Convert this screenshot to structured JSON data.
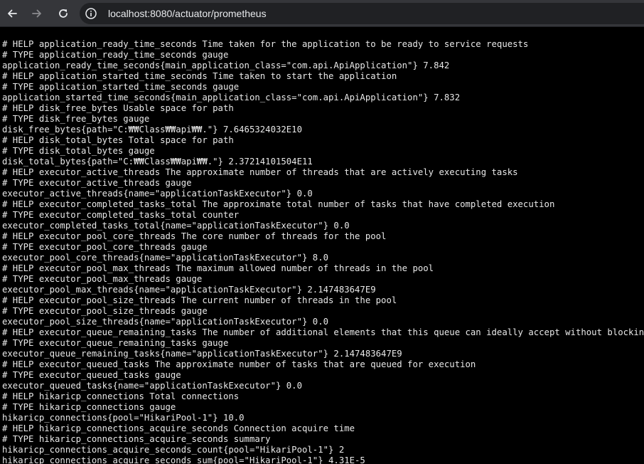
{
  "browser": {
    "url": "localhost:8080/actuator/prometheus"
  },
  "lines": [
    "# HELP application_ready_time_seconds Time taken for the application to be ready to service requests",
    "# TYPE application_ready_time_seconds gauge",
    "application_ready_time_seconds{main_application_class=\"com.api.ApiApplication\"} 7.842",
    "# HELP application_started_time_seconds Time taken to start the application",
    "# TYPE application_started_time_seconds gauge",
    "application_started_time_seconds{main_application_class=\"com.api.ApiApplication\"} 7.832",
    "# HELP disk_free_bytes Usable space for path",
    "# TYPE disk_free_bytes gauge",
    "disk_free_bytes{path=\"C:₩₩Class₩₩api₩₩.\"} 7.6465324032E10",
    "# HELP disk_total_bytes Total space for path",
    "# TYPE disk_total_bytes gauge",
    "disk_total_bytes{path=\"C:₩₩Class₩₩api₩₩.\"} 2.37214101504E11",
    "# HELP executor_active_threads The approximate number of threads that are actively executing tasks",
    "# TYPE executor_active_threads gauge",
    "executor_active_threads{name=\"applicationTaskExecutor\"} 0.0",
    "# HELP executor_completed_tasks_total The approximate total number of tasks that have completed execution",
    "# TYPE executor_completed_tasks_total counter",
    "executor_completed_tasks_total{name=\"applicationTaskExecutor\"} 0.0",
    "# HELP executor_pool_core_threads The core number of threads for the pool",
    "# TYPE executor_pool_core_threads gauge",
    "executor_pool_core_threads{name=\"applicationTaskExecutor\"} 8.0",
    "# HELP executor_pool_max_threads The maximum allowed number of threads in the pool",
    "# TYPE executor_pool_max_threads gauge",
    "executor_pool_max_threads{name=\"applicationTaskExecutor\"} 2.147483647E9",
    "# HELP executor_pool_size_threads The current number of threads in the pool",
    "# TYPE executor_pool_size_threads gauge",
    "executor_pool_size_threads{name=\"applicationTaskExecutor\"} 0.0",
    "# HELP executor_queue_remaining_tasks The number of additional elements that this queue can ideally accept without blocking",
    "# TYPE executor_queue_remaining_tasks gauge",
    "executor_queue_remaining_tasks{name=\"applicationTaskExecutor\"} 2.147483647E9",
    "# HELP executor_queued_tasks The approximate number of tasks that are queued for execution",
    "# TYPE executor_queued_tasks gauge",
    "executor_queued_tasks{name=\"applicationTaskExecutor\"} 0.0",
    "# HELP hikaricp_connections Total connections",
    "# TYPE hikaricp_connections gauge",
    "hikaricp_connections{pool=\"HikariPool-1\"} 10.0",
    "# HELP hikaricp_connections_acquire_seconds Connection acquire time",
    "# TYPE hikaricp_connections_acquire_seconds summary",
    "hikaricp_connections_acquire_seconds_count{pool=\"HikariPool-1\"} 2",
    "hikaricp_connections_acquire_seconds_sum{pool=\"HikariPool-1\"} 4.31E-5"
  ]
}
